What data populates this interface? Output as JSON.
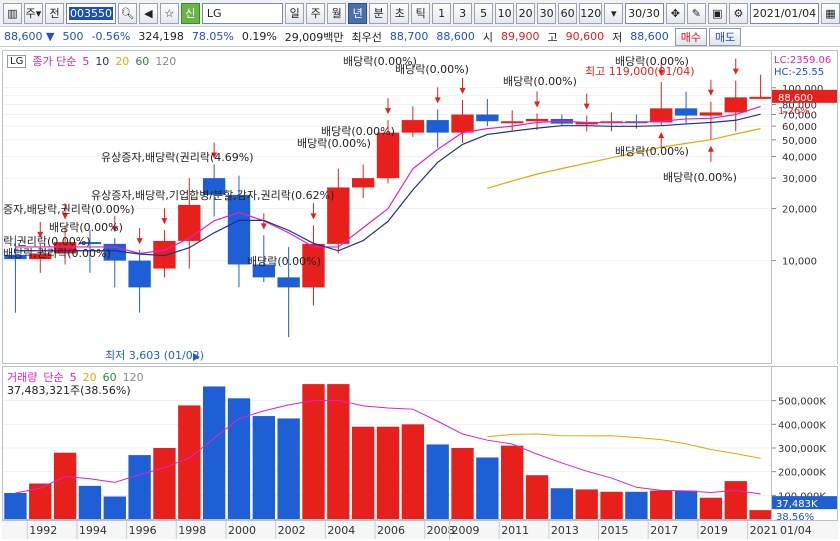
{
  "toolbar": {
    "menu_label": "주",
    "jeon_label": "전",
    "stock_code": "003550",
    "new_badge": "신",
    "stock_name": "LG",
    "periods": [
      "일",
      "주",
      "월",
      "년",
      "분",
      "초",
      "틱"
    ],
    "active_period": "년",
    "intervals": [
      "1",
      "3",
      "5",
      "10",
      "20",
      "30",
      "60",
      "120"
    ],
    "count_value": "30/30",
    "date_value": "2021/01/04"
  },
  "quote": {
    "price": "88,600",
    "change": "500",
    "change_pct": "-0.56%",
    "volume": "324,198",
    "volume_pct": "78.05%",
    "turnover_pct": "0.19%",
    "amount": "29,009백만",
    "best_label": "최우선",
    "ask": "88,700",
    "bid": "88,600",
    "open_label": "시",
    "open": "89,900",
    "high_label": "고",
    "high": "90,600",
    "low_label": "저",
    "low": "88,600",
    "buy_label": "매수",
    "sell_label": "매도"
  },
  "price_panel": {
    "lg_tag": "LG",
    "legend_type": "종가 단순",
    "ma_labels": [
      "5",
      "10",
      "20",
      "60",
      "120"
    ],
    "lc_label": "LC:2359.06",
    "hc_label": "HC:-25.55",
    "last_price_tag": "88,600",
    "last_pct_tag": "1.26%",
    "high_note": "최고 119,000(01/04)",
    "low_note": "최저 3,603 (01/02)",
    "y_ticks": [
      "100,000",
      "90,000",
      "80,000",
      "70,000",
      "60,000",
      "50,000",
      "40,000",
      "30,000",
      "20,000",
      "10,000"
    ],
    "annotations": [
      "배당락(0.00%)",
      "배당락(0.00%)",
      "배당락(0.00%)",
      "배당락(0.00%)",
      "배당락(0.00%)",
      "배당락(0.00%)",
      "배당락(0.00%)",
      "배당락(0.00%)",
      "배당락(0.00%)",
      "배당락(0.00%)",
      "유상증자,배당락(권리락(4.69%)",
      "유상증자,배당락,기업합병/분할,감자,권리락(0.62%)",
      "증자,배당락,권리락(0.00%)",
      "락,권리락(0.00%)",
      "배당락,권리락(0.00%)"
    ]
  },
  "volume_panel": {
    "legend_title": "거래량",
    "legend_type": "단순",
    "ma_labels": [
      "5",
      "20",
      "60",
      "120"
    ],
    "current_volume": "37,483,321주(38.56%)",
    "y_ticks": [
      "500,000K",
      "400,000K",
      "300,000K",
      "200,000K",
      "100,000K"
    ],
    "last_volume_tag": "37,483K",
    "last_volume_pct": "38.56%"
  },
  "x_axis": {
    "labels": [
      "1992",
      "1994",
      "1996",
      "1998",
      "2000",
      "2002",
      "2004",
      "2006",
      "2008",
      "2009",
      "2011",
      "2013",
      "2015",
      "2017",
      "2019",
      "2021"
    ],
    "corner_label": "01/04"
  },
  "colors": {
    "up": "#e8201b",
    "down": "#1f5fd6",
    "ma5": "#e020c8",
    "ma10": "#1d2f8f",
    "ma20": "#e8a800"
  },
  "chart_data": {
    "type": "candlestick",
    "x": [
      "1991",
      "1992",
      "1993",
      "1994",
      "1995",
      "1996",
      "1997",
      "1998",
      "1999",
      "2000",
      "2001",
      "2002",
      "2003",
      "2004",
      "2005",
      "2006",
      "2007",
      "2008",
      "2009",
      "2010",
      "2011",
      "2012",
      "2013",
      "2014",
      "2015",
      "2016",
      "2017",
      "2018",
      "2019",
      "2020",
      "2021"
    ],
    "open": [
      10800,
      10200,
      11000,
      12800,
      12500,
      10000,
      9000,
      13000,
      30000,
      24000,
      9500,
      8000,
      7000,
      12500,
      26500,
      30000,
      55000,
      65000,
      55000,
      70000,
      64000,
      64000,
      66000,
      62000,
      63000,
      64000,
      63000,
      76000,
      69000,
      72000,
      88000
    ],
    "close": [
      10200,
      11000,
      12800,
      12500,
      10000,
      7000,
      13000,
      21000,
      24000,
      9500,
      8000,
      7000,
      12500,
      26500,
      30000,
      55000,
      65000,
      55000,
      70000,
      64000,
      64000,
      66000,
      62000,
      63000,
      64000,
      63000,
      76000,
      69000,
      72000,
      88000,
      88600
    ],
    "high": [
      14000,
      12500,
      16000,
      15000,
      13500,
      11500,
      15000,
      30000,
      36000,
      31000,
      14000,
      12000,
      16000,
      34000,
      36000,
      65000,
      78000,
      75000,
      85000,
      86000,
      74000,
      71000,
      70000,
      69000,
      72000,
      70000,
      108000,
      95000,
      83000,
      110000,
      119000
    ],
    "low": [
      5000,
      8500,
      9500,
      8500,
      7000,
      5000,
      8000,
      9000,
      18000,
      7000,
      7500,
      3603,
      5500,
      11000,
      23000,
      28000,
      52000,
      45000,
      48000,
      60000,
      56000,
      57000,
      60000,
      56000,
      56000,
      58000,
      60000,
      62000,
      50000,
      56000,
      86000
    ],
    "volume_k": [
      110000,
      150000,
      280000,
      140000,
      95000,
      270000,
      300000,
      480000,
      560000,
      510000,
      435000,
      425000,
      570000,
      570000,
      390000,
      390000,
      400000,
      315000,
      300000,
      260000,
      310000,
      185000,
      130000,
      125000,
      115000,
      115000,
      120000,
      120000,
      90000,
      160000,
      37483
    ],
    "ma5_price": [
      12000,
      12000,
      12000,
      12000,
      12000,
      11000,
      11500,
      13500,
      17000,
      19000,
      17000,
      14500,
      12000,
      12000,
      15500,
      20000,
      34000,
      44000,
      55000,
      58000,
      60000,
      63000,
      64000,
      63000,
      63000,
      63000,
      64000,
      66000,
      66500,
      70000,
      78000
    ],
    "ylim_price": [
      0,
      120000
    ],
    "ylim_volume": [
      0,
      600000
    ],
    "ylabel": "",
    "xlabel": ""
  }
}
